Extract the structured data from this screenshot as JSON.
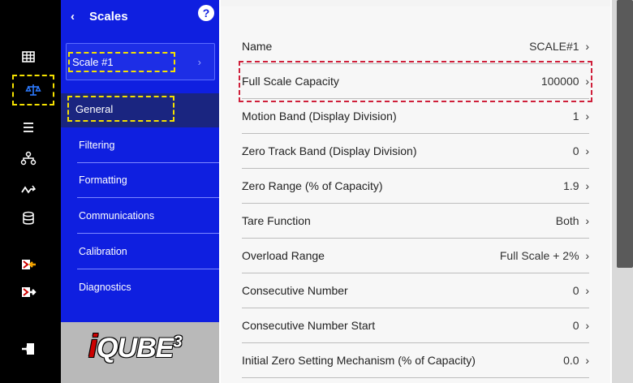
{
  "menu": {
    "title": "Scales",
    "back_glyph": "‹",
    "help_glyph": "?",
    "scale_item": "Scale #1",
    "scale_chevron": "›",
    "active_sub": "General",
    "sub_items": [
      "Filtering",
      "Formatting",
      "Communications",
      "Calibration",
      "Diagnostics"
    ]
  },
  "rail": {
    "icons": [
      "grid-icon",
      "scale-balance-icon",
      "list-icon",
      "network-icon",
      "signal-icon",
      "database-icon",
      "export-icon",
      "import-icon",
      "exit-icon"
    ],
    "active_index": 1,
    "accent_color": "#f5e100"
  },
  "logo": {
    "text": "QUBE",
    "superscript": "3",
    "prefix_glyph": "i"
  },
  "settings": [
    {
      "label": "Name",
      "value": "SCALE#1"
    },
    {
      "label": "Full Scale Capacity",
      "value": "100000"
    },
    {
      "label": "Motion Band (Display Division)",
      "value": "1"
    },
    {
      "label": "Zero Track Band (Display Division)",
      "value": "0"
    },
    {
      "label": "Zero Range (% of Capacity)",
      "value": "1.9"
    },
    {
      "label": "Tare Function",
      "value": "Both"
    },
    {
      "label": "Overload Range",
      "value": "Full Scale + 2%"
    },
    {
      "label": "Consecutive Number",
      "value": "0"
    },
    {
      "label": "Consecutive Number Start",
      "value": "0"
    },
    {
      "label": "Initial Zero Setting Mechanism (% of Capacity)",
      "value": "0.0"
    }
  ],
  "colors": {
    "menu_blue": "#0f1fe0",
    "highlight_red": "#cf1f3a"
  }
}
